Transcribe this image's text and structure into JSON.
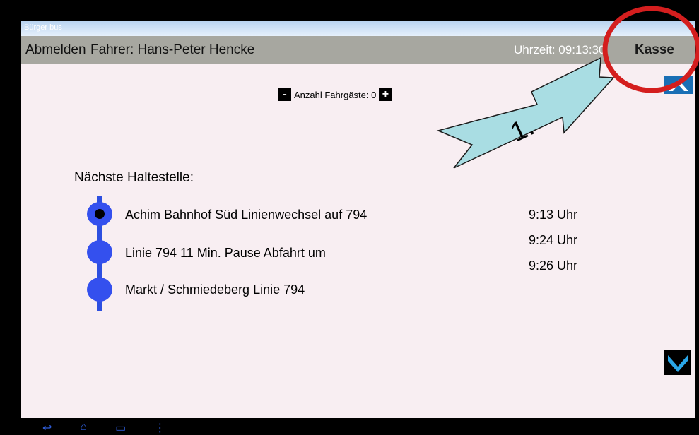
{
  "app": {
    "title": "Bürger bus"
  },
  "topbar": {
    "logout": "Abmelden",
    "driver": "Fahrer: Hans-Peter Hencke",
    "clock": "Uhrzeit: 09:13:30",
    "kasse": "Kasse"
  },
  "passengers": {
    "minus": "-",
    "label": "Anzahl Fahrgäste: 0",
    "plus": "+"
  },
  "section": {
    "title": "Nächste Haltestelle:"
  },
  "stops": [
    {
      "name": "Achim Bahnhof Süd Linienwechsel auf 794",
      "time": "9:13 Uhr"
    },
    {
      "name": "Linie 794 11 Min. Pause   Abfahrt um",
      "time": "9:24 Uhr"
    },
    {
      "name": "Markt / Schmiedeberg Linie 794",
      "time": "9:26 Uhr"
    }
  ],
  "annotation": {
    "step": "1."
  },
  "colors": {
    "accent_blue": "#3450ee",
    "topbar": "#a7a7a0",
    "annotation_red": "#d41e1e",
    "arrow": "#a9dde3"
  }
}
